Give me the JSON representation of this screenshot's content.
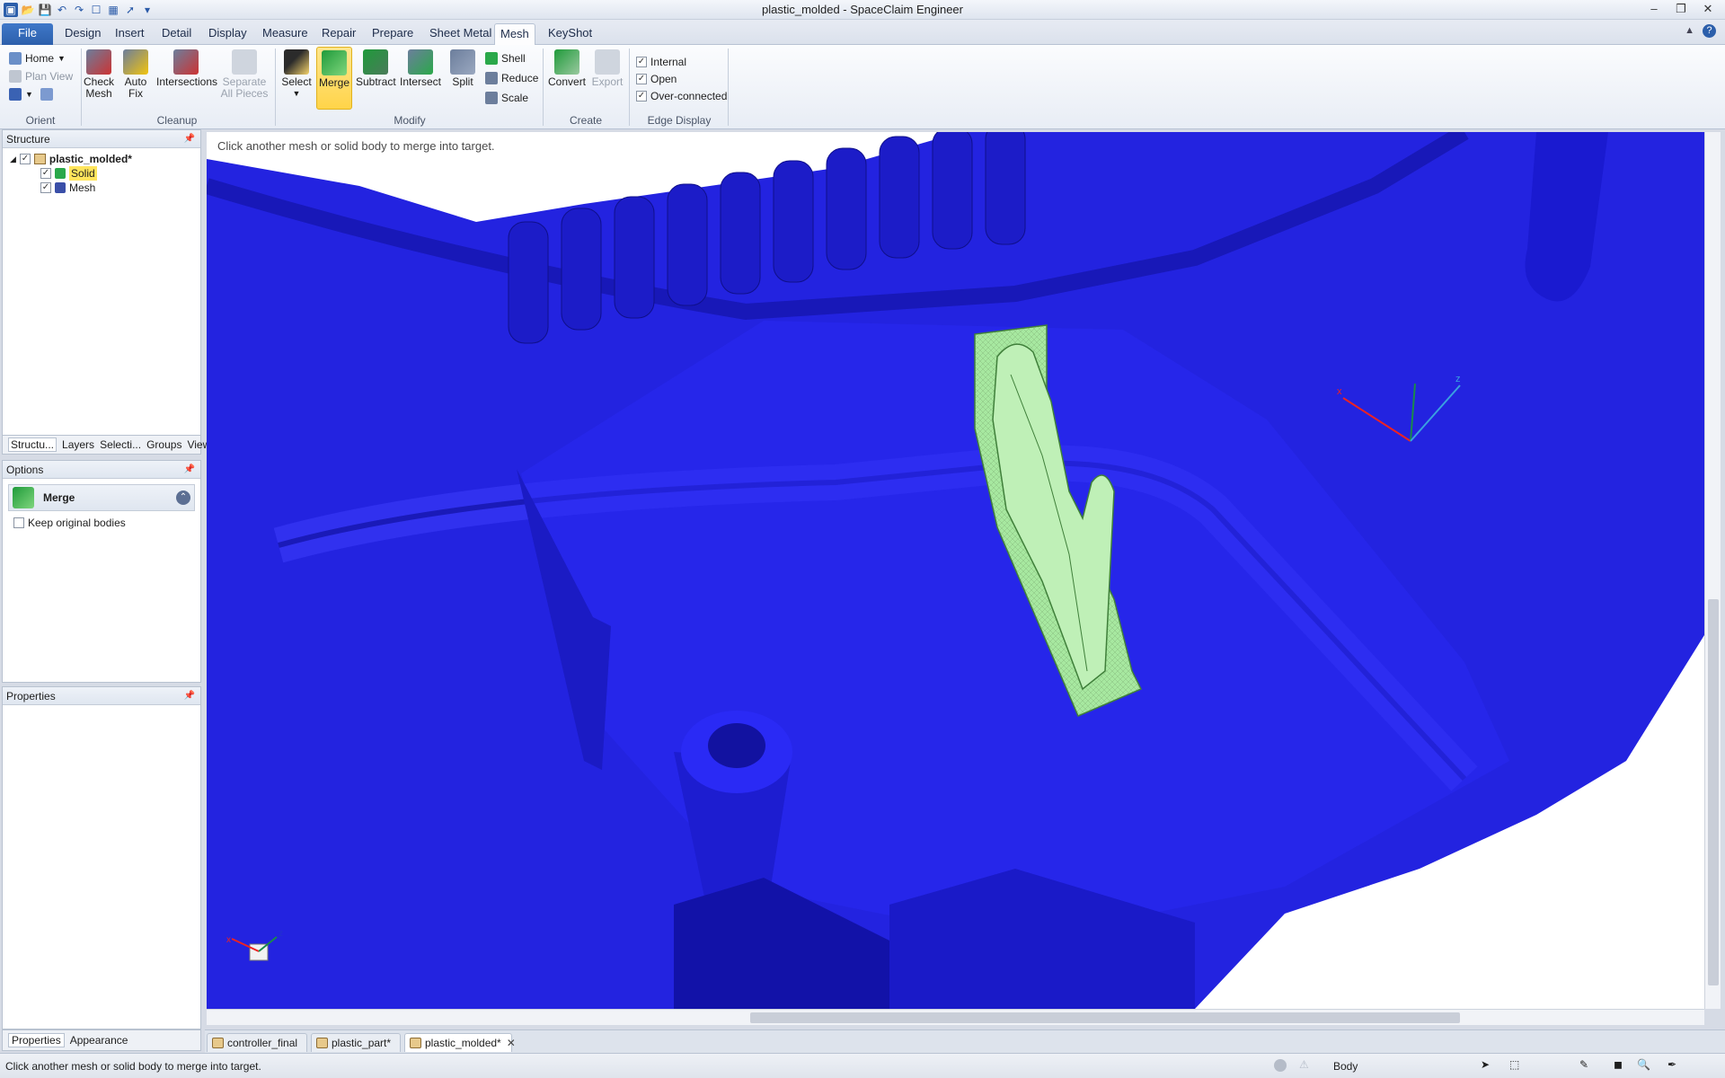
{
  "window": {
    "title": "plastic_molded - SpaceClaim Engineer"
  },
  "ribbon_tabs": [
    "File",
    "Design",
    "Insert",
    "Detail",
    "Display",
    "Measure",
    "Repair",
    "Prepare",
    "Sheet Metal",
    "Mesh",
    "KeyShot"
  ],
  "active_tab": "Mesh",
  "ribbon": {
    "orient": {
      "home": "Home",
      "plan_view": "Plan View",
      "label": "Orient"
    },
    "cleanup": {
      "check_mesh": "Check\nMesh",
      "auto_fix": "Auto\nFix",
      "intersections": "Intersections",
      "separate": "Separate\nAll Pieces",
      "label": "Cleanup"
    },
    "modify": {
      "select": "Select",
      "merge": "Merge",
      "subtract": "Subtract",
      "intersect": "Intersect",
      "split": "Split",
      "shell": "Shell",
      "reduce": "Reduce",
      "scale": "Scale",
      "label": "Modify"
    },
    "create": {
      "convert": "Convert",
      "export": "Export",
      "label": "Create"
    },
    "edge_display": {
      "internal": "Internal",
      "open": "Open",
      "over_connected": "Over-connected",
      "label": "Edge Display"
    }
  },
  "structure": {
    "title": "Structure",
    "root": "plastic_molded*",
    "children": [
      "Solid",
      "Mesh"
    ],
    "tabs": [
      "Structu...",
      "Layers",
      "Selecti...",
      "Groups",
      "Views"
    ]
  },
  "options": {
    "title": "Options",
    "tool": "Merge",
    "keep_original": "Keep original bodies"
  },
  "properties": {
    "title": "Properties",
    "tabs": [
      "Properties",
      "Appearance"
    ]
  },
  "viewport": {
    "hint": "Click another mesh or solid body to merge into target."
  },
  "doc_tabs": [
    "controller_final",
    "plastic_part*",
    "plastic_molded*"
  ],
  "status": {
    "message": "Click another mesh or solid body to merge into target.",
    "selection_filter": "Body"
  },
  "colors": {
    "model_blue": "#2424e6",
    "highlight_green": "#9ee69a",
    "accent": "#2c5fab"
  }
}
